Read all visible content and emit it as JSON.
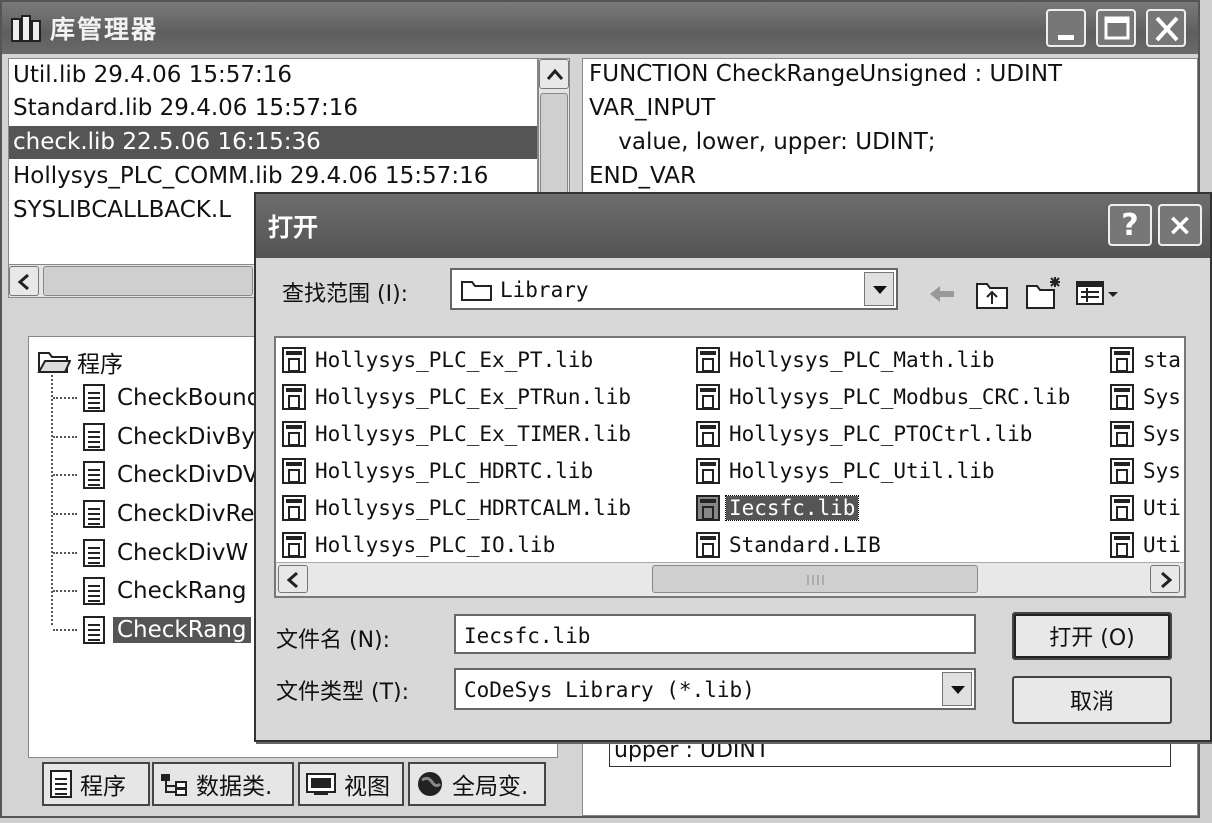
{
  "window": {
    "title": "库管理器"
  },
  "libraries": [
    {
      "label": "Util.lib 29.4.06 15:57:16",
      "selected": false
    },
    {
      "label": "Standard.lib 29.4.06 15:57:16",
      "selected": false
    },
    {
      "label": "check.lib 22.5.06 16:15:36",
      "selected": true
    },
    {
      "label": "Hollysys_PLC_COMM.lib 29.4.06 15:57:16",
      "selected": false
    },
    {
      "label": "SYSLIBCALLBACK.L",
      "selected": false
    }
  ],
  "code": [
    "FUNCTION CheckRangeUnsigned : UDINT",
    "VAR_INPUT",
    "    value, lower, upper: UDINT;",
    "END_VAR"
  ],
  "tree": {
    "root": "程序",
    "items": [
      {
        "label": "CheckBound",
        "selected": false
      },
      {
        "label": "CheckDivBy",
        "selected": false
      },
      {
        "label": "CheckDivDV",
        "selected": false
      },
      {
        "label": "CheckDivRe",
        "selected": false
      },
      {
        "label": "CheckDivW",
        "selected": false
      },
      {
        "label": "CheckRang",
        "selected": false
      },
      {
        "label": "CheckRang",
        "selected": true
      }
    ]
  },
  "tabs": [
    "程序",
    "数据类.",
    "视图",
    "全局变."
  ],
  "right_lower": {
    "text": "upper : UDINT"
  },
  "dialog": {
    "title": "打开",
    "help": "?",
    "close": "×",
    "look_in_label": "查找范围 (I):",
    "look_in_value": "Library",
    "files": [
      [
        {
          "name": "Hollysys_PLC_Ex_PT.lib",
          "selected": false
        },
        {
          "name": "Hollysys_PLC_Ex_PTRun.lib",
          "selected": false
        },
        {
          "name": "Hollysys_PLC_Ex_TIMER.lib",
          "selected": false
        },
        {
          "name": "Hollysys_PLC_HDRTC.lib",
          "selected": false
        },
        {
          "name": "Hollysys_PLC_HDRTCALM.lib",
          "selected": false
        },
        {
          "name": "Hollysys_PLC_IO.lib",
          "selected": false
        }
      ],
      [
        {
          "name": "Hollysys_PLC_Math.lib",
          "selected": false
        },
        {
          "name": "Hollysys_PLC_Modbus_CRC.lib",
          "selected": false
        },
        {
          "name": "Hollysys_PLC_PTOCtrl.lib",
          "selected": false
        },
        {
          "name": "Hollysys_PLC_Util.lib",
          "selected": false
        },
        {
          "name": "Iecsfc.lib",
          "selected": true
        },
        {
          "name": "Standard.LIB",
          "selected": false
        }
      ],
      [
        {
          "name": "sta",
          "selected": false
        },
        {
          "name": "Sys",
          "selected": false
        },
        {
          "name": "Sys",
          "selected": false
        },
        {
          "name": "Sys",
          "selected": false
        },
        {
          "name": "Uti",
          "selected": false
        },
        {
          "name": "Uti",
          "selected": false
        }
      ]
    ],
    "filename_label": "文件名 (N):",
    "filename_value": "Iecsfc.lib",
    "filetype_label": "文件类型 (T):",
    "filetype_value": "CoDeSys Library (*.lib)",
    "open_button": "打开 (O)",
    "cancel_button": "取消"
  }
}
